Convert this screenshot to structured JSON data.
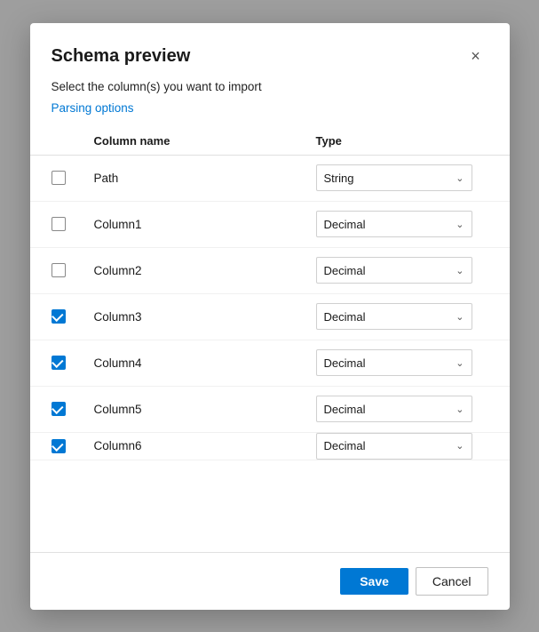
{
  "dialog": {
    "title": "Schema preview",
    "subtitle": "Select the column(s) you want to import",
    "parsing_link": "Parsing options",
    "close_label": "×"
  },
  "table": {
    "col_name_header": "Column name",
    "col_type_header": "Type",
    "rows": [
      {
        "id": "path",
        "name": "Path",
        "type": "String",
        "checked": false
      },
      {
        "id": "col1",
        "name": "Column1",
        "type": "Decimal",
        "checked": false
      },
      {
        "id": "col2",
        "name": "Column2",
        "type": "Decimal",
        "checked": false
      },
      {
        "id": "col3",
        "name": "Column3",
        "type": "Decimal",
        "checked": true
      },
      {
        "id": "col4",
        "name": "Column4",
        "type": "Decimal",
        "checked": true
      },
      {
        "id": "col5",
        "name": "Column5",
        "type": "Decimal",
        "checked": true
      },
      {
        "id": "col6",
        "name": "Column6",
        "type": "Decimal",
        "checked": true
      }
    ]
  },
  "footer": {
    "save_label": "Save",
    "cancel_label": "Cancel"
  }
}
